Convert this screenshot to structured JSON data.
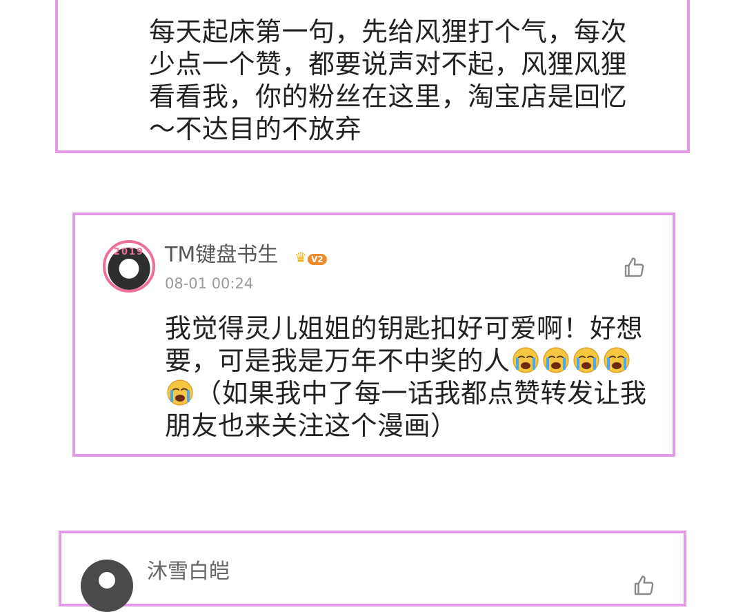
{
  "comments": [
    {
      "text": "每天起床第一句，先给风狸打个气，每次\n少点一个赞，都要说声对不起，风狸风狸\n看看我，你的粉丝在这里，淘宝店是回忆\n～不达目的不放弃"
    },
    {
      "username": "TM键盘书生",
      "vip_level": "V2",
      "avatar_text": "2019",
      "timestamp": "08-01 00:24",
      "text_line1": "我觉得灵儿姐姐的钥匙扣好可爱啊！好想",
      "text_line2_before": "要，可是我是万年不中奖的人",
      "text_line3_after": "（如果我中了每一话我都点赞转发让我",
      "text_line4": "朋友也来关注这个漫画）",
      "emoji": "loudly-crying-face",
      "emoji_count_line2": 4,
      "emoji_count_line3": 1
    },
    {
      "username": "沐雪白皑"
    }
  ],
  "icons": {
    "like": "thumbs-up-outline-icon",
    "crown": "crown-icon"
  },
  "colors": {
    "card_border": "#e39ae6",
    "vip_badge": "#f08a2c",
    "text": "#222222",
    "muted": "#9a9a9a"
  }
}
